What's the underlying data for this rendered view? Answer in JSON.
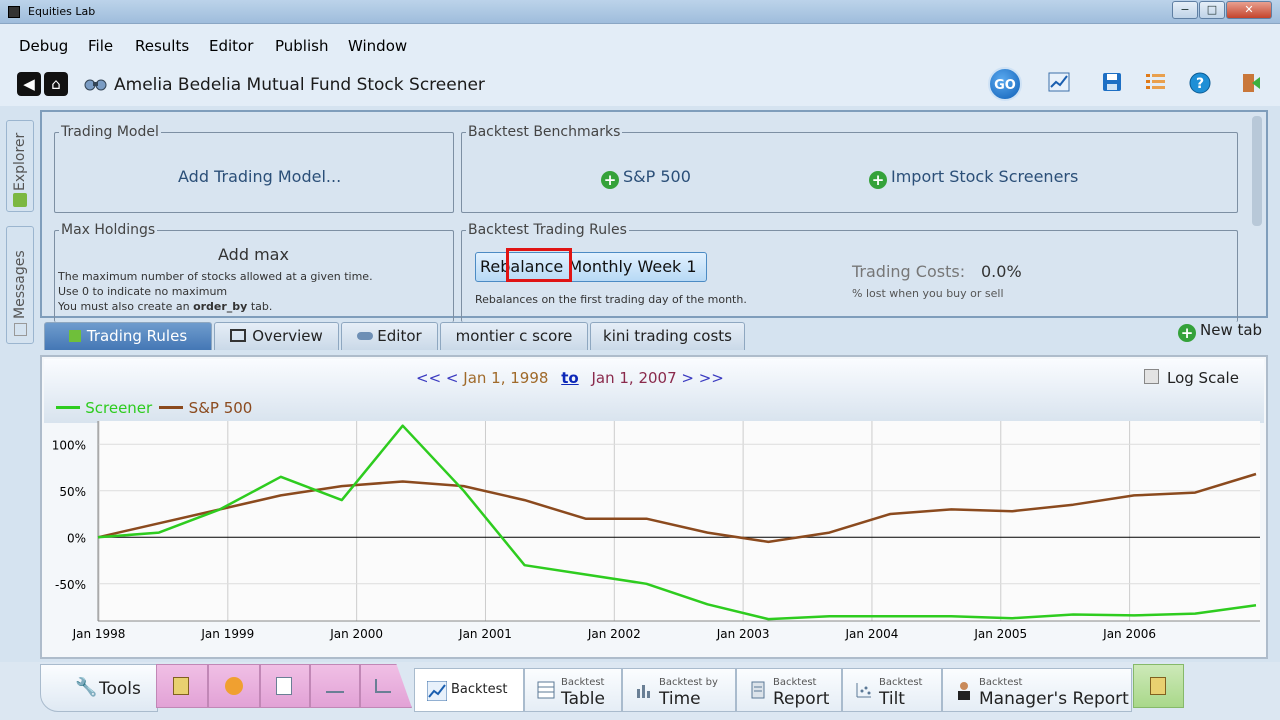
{
  "window": {
    "title": "Equities Lab",
    "minimize": "−",
    "maximize": "□",
    "close": "✕"
  },
  "menu": [
    "Debug",
    "File",
    "Results",
    "Editor",
    "Publish",
    "Window"
  ],
  "toolbar": {
    "screen_title": "Amelia Bedelia Mutual Fund Stock Screener",
    "go_label": "GO"
  },
  "side_tabs": {
    "explorer": "Explorer",
    "messages": "Messages"
  },
  "trading_model": {
    "title": "Trading Model",
    "action": "Add Trading Model..."
  },
  "benchmarks": {
    "title": "Backtest Benchmarks",
    "sp500": "S&P 500",
    "import": "Import Stock Screeners"
  },
  "max_holdings": {
    "title": "Max Holdings",
    "action": "Add max",
    "line1": "The maximum number of stocks allowed at a given time.",
    "line2": "Use 0 to indicate no maximum",
    "line3_pre": "You must also create an ",
    "line3_bold": "order_by",
    "line3_post": " tab."
  },
  "trading_rules": {
    "title": "Backtest Trading Rules",
    "rebalance": "Rebalance Monthly Week 1",
    "rebalance_desc": "Rebalances on the first trading day of the month.",
    "costs_label": "Trading Costs:",
    "costs_value": "0.0%",
    "costs_desc": "% lost when you buy or sell"
  },
  "tabs": [
    "Trading Rules",
    "Overview",
    "Editor",
    "montier c score",
    "kini trading costs"
  ],
  "new_tab": "New tab",
  "range": {
    "prev": "<< <",
    "start": "Jan 1, 1998",
    "to": "to",
    "end": "Jan 1, 2007",
    "next": "> >>"
  },
  "log_scale": "Log Scale",
  "legend": [
    {
      "name": "Screener",
      "color": "#2ecc1f"
    },
    {
      "name": "S&P 500",
      "color": "#8b4a1e"
    }
  ],
  "bottom_tabs": [
    {
      "cap": "",
      "lbl": "Backtest"
    },
    {
      "cap": "Backtest",
      "lbl": "Table"
    },
    {
      "cap": "Backtest by",
      "lbl": "Time"
    },
    {
      "cap": "Backtest",
      "lbl": "Report"
    },
    {
      "cap": "Backtest",
      "lbl": "Tilt"
    },
    {
      "cap": "Backtest",
      "lbl": "Manager's Report"
    }
  ],
  "tools_label": "Tools",
  "chart_data": {
    "type": "line",
    "x": [
      "Jan 1998",
      "Jul 1998",
      "Jan 1999",
      "Jul 1999",
      "Jan 2000",
      "Mar 2000",
      "Jul 2000",
      "Jan 2001",
      "Jul 2001",
      "Jan 2002",
      "Jul 2002",
      "Jan 2003",
      "Jul 2003",
      "Jan 2004",
      "Jul 2004",
      "Jan 2005",
      "Jul 2005",
      "Jan 2006",
      "Jul 2006",
      "Dec 2006"
    ],
    "x_tick_labels": [
      "Jan 1998",
      "Jan 1999",
      "Jan 2000",
      "Jan 2001",
      "Jan 2002",
      "Jan 2003",
      "Jan 2004",
      "Jan 2005",
      "Jan 2006"
    ],
    "y_tick_labels": [
      "100%",
      "50%",
      "0%",
      "-50%"
    ],
    "ylim": [
      -90,
      125
    ],
    "series": [
      {
        "name": "Screener",
        "values": [
          0,
          5,
          30,
          65,
          40,
          120,
          50,
          -30,
          -40,
          -50,
          -72,
          -88,
          -85,
          -85,
          -85,
          -87,
          -83,
          -84,
          -82,
          -73
        ]
      },
      {
        "name": "S&P 500",
        "values": [
          0,
          15,
          30,
          45,
          55,
          60,
          55,
          40,
          20,
          20,
          5,
          -5,
          5,
          25,
          30,
          28,
          35,
          45,
          48,
          68
        ]
      }
    ]
  }
}
